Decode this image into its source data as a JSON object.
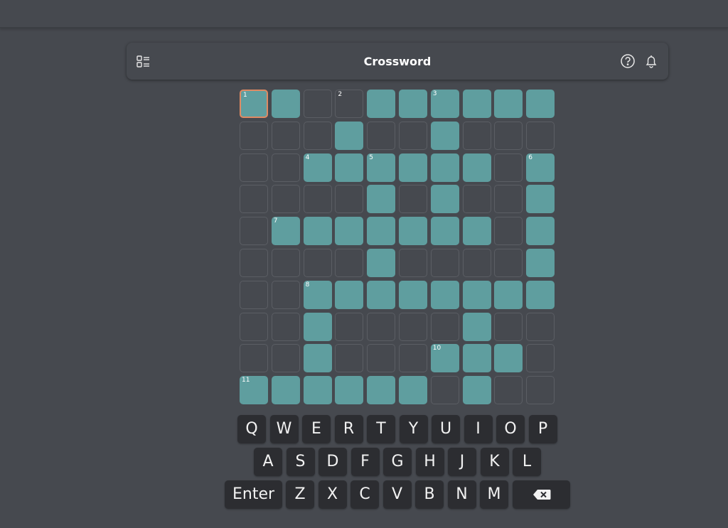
{
  "header": {
    "title": "Crossword",
    "icons": {
      "clues": "clue-list-icon",
      "help": "help-circle-icon",
      "notifications": "bell-icon"
    }
  },
  "colors": {
    "background": "#46494f",
    "letter_cell": "#5f9e9f",
    "selected_border": "#e08a63",
    "key": "#2c2d31"
  },
  "grid": {
    "size": 10,
    "rows": [
      "1100111111",
      "0001001000",
      "0011111101",
      "0000101001",
      "0111111101",
      "0000100001",
      "0011111111",
      "0010000100",
      "0010001110",
      "1111110100"
    ],
    "numbers": [
      {
        "r": 0,
        "c": 0,
        "n": "1"
      },
      {
        "r": 0,
        "c": 3,
        "n": "2"
      },
      {
        "r": 0,
        "c": 6,
        "n": "3"
      },
      {
        "r": 2,
        "c": 2,
        "n": "4"
      },
      {
        "r": 2,
        "c": 4,
        "n": "5"
      },
      {
        "r": 2,
        "c": 9,
        "n": "6"
      },
      {
        "r": 4,
        "c": 1,
        "n": "7"
      },
      {
        "r": 6,
        "c": 2,
        "n": "8"
      },
      {
        "r": 8,
        "c": 6,
        "n": "10"
      },
      {
        "r": 9,
        "c": 0,
        "n": "11"
      }
    ],
    "selected": {
      "r": 0,
      "c": 0
    }
  },
  "keyboard": {
    "rows": [
      [
        "Q",
        "W",
        "E",
        "R",
        "T",
        "Y",
        "U",
        "I",
        "O",
        "P"
      ],
      [
        "A",
        "S",
        "D",
        "F",
        "G",
        "H",
        "J",
        "K",
        "L"
      ],
      [
        "Enter",
        "Z",
        "X",
        "C",
        "V",
        "B",
        "N",
        "M",
        "Backspace"
      ]
    ],
    "backspace_icon": "backspace-icon"
  }
}
